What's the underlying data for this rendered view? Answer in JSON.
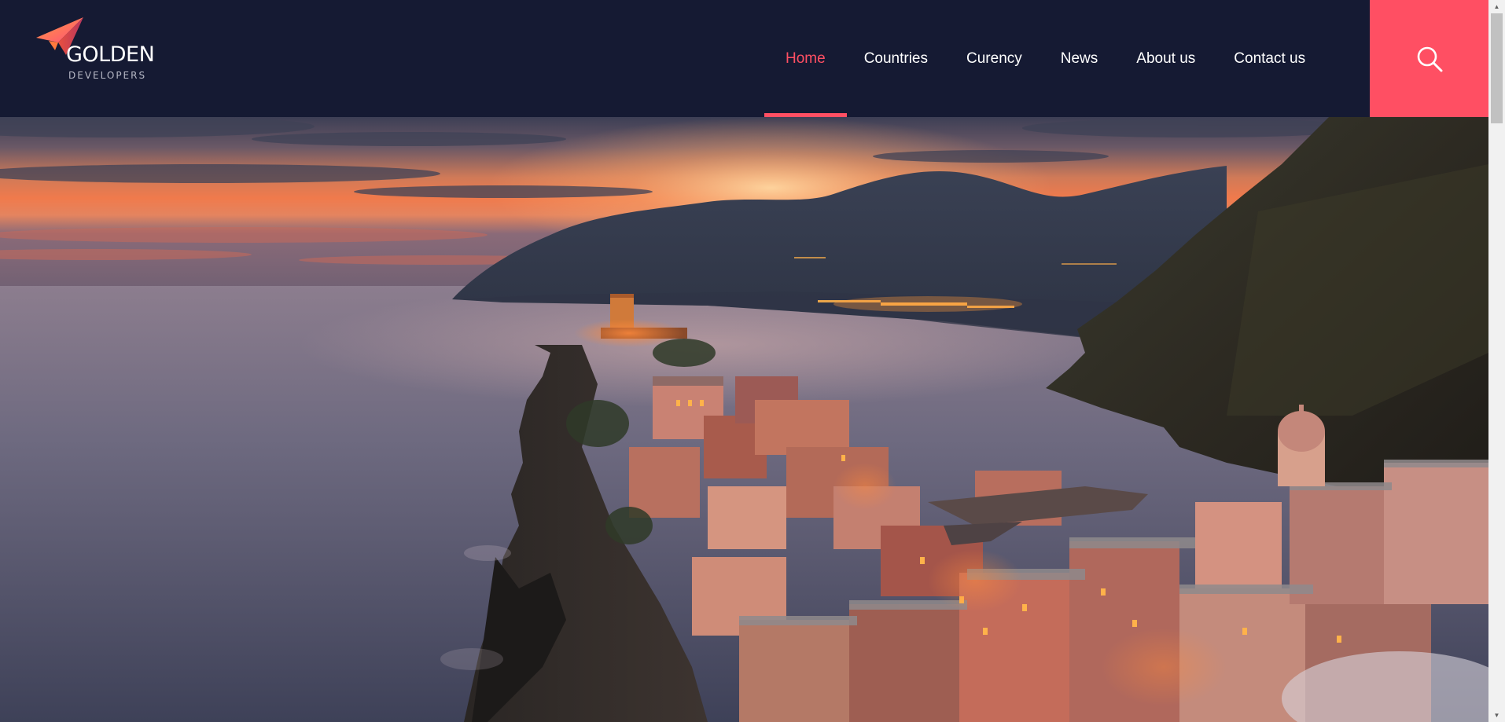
{
  "brand": {
    "name": "GOLDEN",
    "tagline": "DEVELOPERS",
    "logo_icon": "paper-plane-icon"
  },
  "nav": {
    "items": [
      {
        "label": "Home",
        "active": true
      },
      {
        "label": "Countries",
        "active": false
      },
      {
        "label": "Curency",
        "active": false
      },
      {
        "label": "News",
        "active": false
      },
      {
        "label": "About us",
        "active": false
      },
      {
        "label": "Contact us",
        "active": false
      }
    ],
    "search_icon": "search-icon"
  },
  "hero": {
    "image": "coastal-village-at-sunset"
  },
  "colors": {
    "header_bg": "#151a33",
    "accent": "#ff4f63",
    "nav_text": "#ffffff"
  }
}
